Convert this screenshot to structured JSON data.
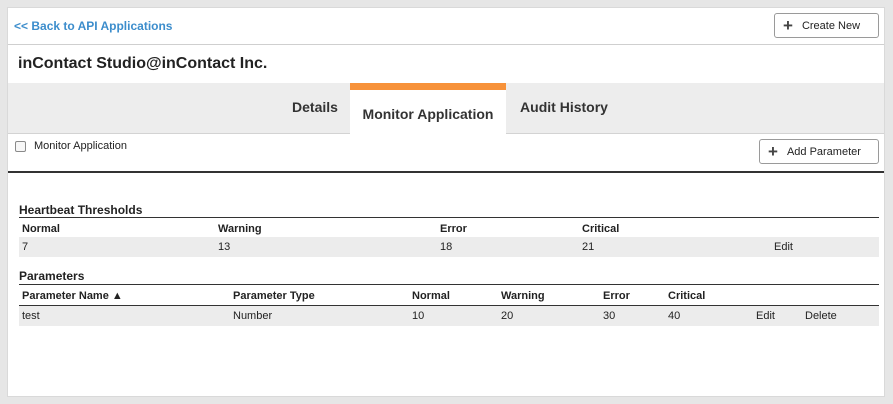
{
  "header": {
    "back_link": "<< Back to API Applications",
    "create_new_label": "Create New"
  },
  "page_title": "inContact Studio@inContact Inc.",
  "tabs": [
    {
      "label": "Details"
    },
    {
      "label": "Monitor Application"
    },
    {
      "label": "Audit History"
    }
  ],
  "active_tab": "Monitor Application",
  "accent_color": "#f7923a",
  "link_color": "#3c8dcc",
  "monitor": {
    "checkbox_label": "Monitor Application",
    "checked": false,
    "add_parameter_label": "Add Parameter"
  },
  "heartbeat": {
    "title": "Heartbeat Thresholds",
    "columns": [
      "Normal",
      "Warning",
      "Error",
      "Critical"
    ],
    "row": {
      "normal": "7",
      "warning": "13",
      "error": "18",
      "critical": "21",
      "edit": "Edit"
    }
  },
  "parameters": {
    "title": "Parameters",
    "columns": [
      "Parameter Name",
      "Parameter Type",
      "Normal",
      "Warning",
      "Error",
      "Critical"
    ],
    "sort_indicator": "▲",
    "rows": [
      {
        "name": "test",
        "type": "Number",
        "normal": "10",
        "warning": "20",
        "error": "30",
        "critical": "40",
        "edit": "Edit",
        "delete": "Delete"
      }
    ]
  }
}
